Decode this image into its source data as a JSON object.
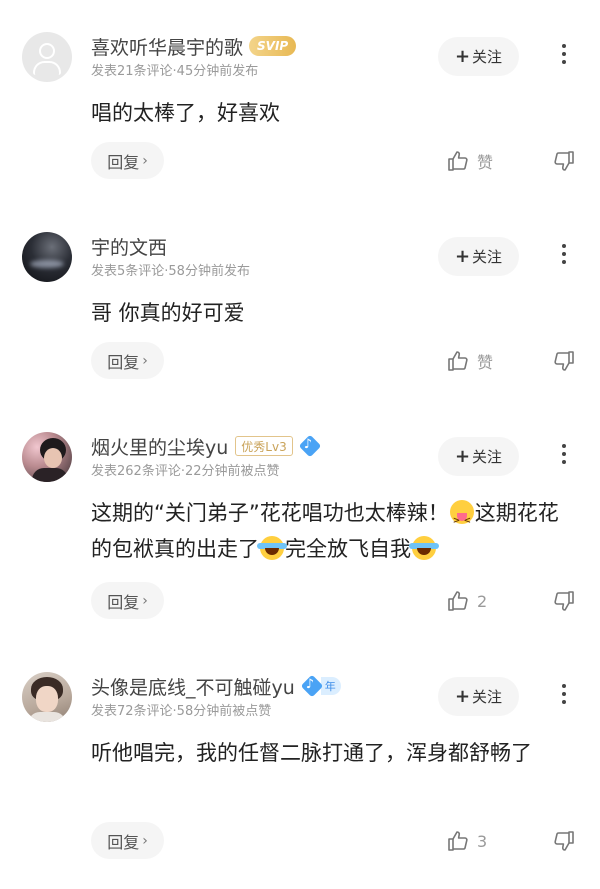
{
  "comments": [
    {
      "username": "喜欢听华晨宇的歌",
      "badge": "SVIP",
      "meta": "发表21条评论·45分钟前发布",
      "follow_label": "关注",
      "content": "唱的太棒了，好喜欢",
      "reply_label": "回复",
      "like_label": "赞"
    },
    {
      "username": "宇的文西",
      "meta": "发表5条评论·58分钟前发布",
      "follow_label": "关注",
      "content": "哥 你真的好可爱",
      "reply_label": "回复",
      "like_label": "赞"
    },
    {
      "username": "烟火里的尘埃yu",
      "badge": "优秀Lv3",
      "meta": "发表262条评论·22分钟前被点赞",
      "follow_label": "关注",
      "content_part1": "这期的“关门弟子”花花唱功也太棒辣！",
      "content_part2": "这期花花的包袱真的出走了",
      "content_part3": "完全放飞自我",
      "reply_label": "回复",
      "like_count": "2"
    },
    {
      "username": "头像是底线_不可触碰yu",
      "badge_year": "年",
      "meta": "发表72条评论·58分钟前被点赞",
      "follow_label": "关注",
      "content": "听他唱完，我的任督二脉打通了，浑身都舒畅了",
      "reply_label": "回复",
      "like_count": "3"
    }
  ],
  "icons": {
    "plus": "+",
    "chevron": "›",
    "like": "thumbs-up-icon",
    "dislike": "thumbs-down-icon",
    "more": "more-vertical-icon"
  },
  "colors": {
    "svip_gold": "#e8b954",
    "level_gold": "#c9a35a",
    "music_blue": "#4aa3f5",
    "meta_gray": "#9a9a9a"
  }
}
